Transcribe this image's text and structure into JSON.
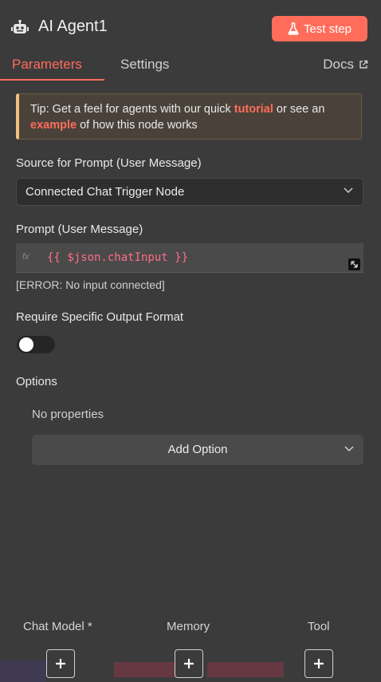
{
  "header": {
    "title": "AI Agent1",
    "test_button": "Test step"
  },
  "tabs": {
    "parameters": "Parameters",
    "settings": "Settings",
    "docs": "Docs"
  },
  "tip": {
    "prefix": "Tip: Get a feel for agents with our quick ",
    "link1": "tutorial",
    "middle": " or see an ",
    "link2": "example",
    "suffix": " of how this node works"
  },
  "source": {
    "label": "Source for Prompt (User Message)",
    "value": "Connected Chat Trigger Node"
  },
  "prompt": {
    "label": "Prompt (User Message)",
    "expression": "{{ $json.chatInput }}",
    "fx": "fx",
    "error": "[ERROR: No input connected]"
  },
  "output_format": {
    "label": "Require Specific Output Format",
    "enabled": false
  },
  "options": {
    "label": "Options",
    "empty": "No properties",
    "add_button": "Add Option"
  },
  "connectors": {
    "chat_model": "Chat Model *",
    "memory": "Memory",
    "tool": "Tool"
  },
  "colors": {
    "accent": "#ff6d5a",
    "background": "#3b3b3b",
    "tip_border": "#f1c27d"
  }
}
